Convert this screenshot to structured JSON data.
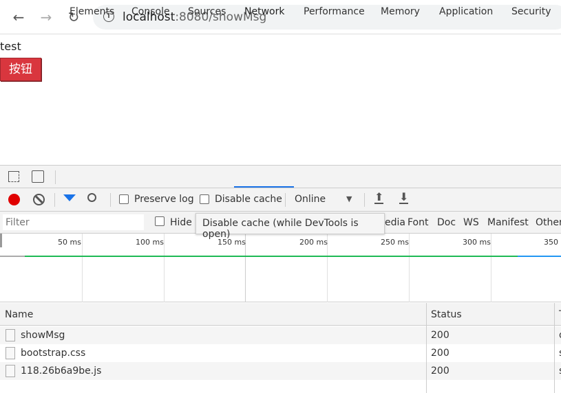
{
  "browser": {
    "url_host": "localhost",
    "url_rest": ":8080/showMsg"
  },
  "page": {
    "text": "test",
    "button": "按钮"
  },
  "devtools": {
    "tabs": [
      "Elements",
      "Console",
      "Sources",
      "Network",
      "Performance",
      "Memory",
      "Application",
      "Security"
    ],
    "active_tab": "Network",
    "toolbar": {
      "preserve_log": "Preserve log",
      "disable_cache": "Disable cache",
      "throttle": "Online"
    },
    "filter": {
      "placeholder": "Filter",
      "hide": "Hide",
      "types": [
        "edia",
        "Font",
        "Doc",
        "WS",
        "Manifest",
        "Other"
      ]
    },
    "tooltip": "Disable cache (while DevTools is open)",
    "timeline_ticks": [
      "50 ms",
      "100 ms",
      "150 ms",
      "200 ms",
      "250 ms",
      "300 ms",
      "350 ms"
    ],
    "table": {
      "headers": [
        "Name",
        "Status",
        "T"
      ],
      "rows": [
        {
          "name": "showMsg",
          "status": "200",
          "type": "d"
        },
        {
          "name": "bootstrap.css",
          "status": "200",
          "type": "s"
        },
        {
          "name": "118.26b6a9be.js",
          "status": "200",
          "type": "s"
        }
      ]
    }
  },
  "colors": {
    "accent": "#1a73e8",
    "record": "#e00000",
    "button": "#d9363e",
    "timeline_green": "#1db954",
    "timeline_blue": "#2196f3"
  }
}
